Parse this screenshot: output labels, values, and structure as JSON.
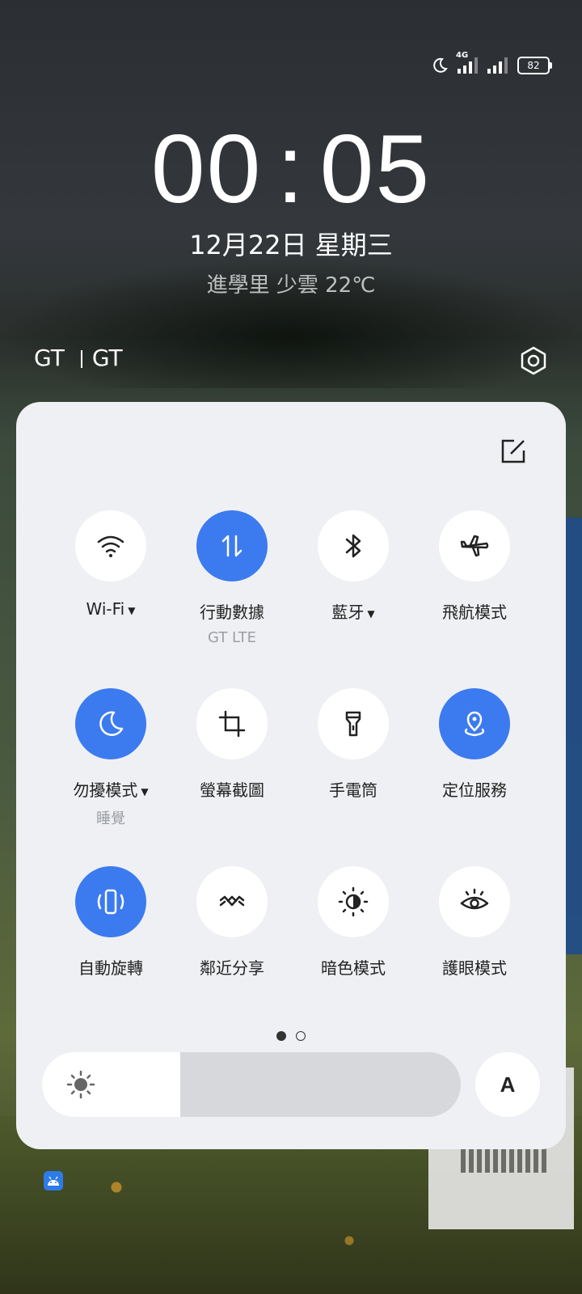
{
  "status_bar": {
    "network_type": "4G",
    "battery_level": "82",
    "icons": [
      "moon-icon",
      "signal-4g-icon",
      "signal-icon",
      "battery-icon"
    ]
  },
  "lockscreen": {
    "time_hours": "00",
    "time_separator": ":",
    "time_minutes": "05",
    "date": "12月22日  星期三",
    "weather": "進學里 少雲 22℃"
  },
  "carrier": {
    "sim1": "GT",
    "sim2": "GT"
  },
  "quick_settings": {
    "accent_color": "#3c7bef",
    "tiles": [
      {
        "label": "Wi-Fi",
        "sub": "",
        "active": false,
        "has_menu": true,
        "icon": "wifi-icon"
      },
      {
        "label": "行動數據",
        "sub": "GT  LTE",
        "active": true,
        "has_menu": false,
        "icon": "mobile-data-icon"
      },
      {
        "label": "藍牙",
        "sub": "",
        "active": false,
        "has_menu": true,
        "icon": "bluetooth-icon"
      },
      {
        "label": "飛航模式",
        "sub": "",
        "active": false,
        "has_menu": false,
        "icon": "airplane-icon"
      },
      {
        "label": "勿擾模式",
        "sub": "睡覺",
        "active": true,
        "has_menu": true,
        "icon": "moon-icon"
      },
      {
        "label": "螢幕截圖",
        "sub": "",
        "active": false,
        "has_menu": false,
        "icon": "crop-icon"
      },
      {
        "label": "手電筒",
        "sub": "",
        "active": false,
        "has_menu": false,
        "icon": "flashlight-icon"
      },
      {
        "label": "定位服務",
        "sub": "",
        "active": true,
        "has_menu": false,
        "icon": "location-icon"
      },
      {
        "label": "自動旋轉",
        "sub": "",
        "active": true,
        "has_menu": false,
        "icon": "auto-rotate-icon"
      },
      {
        "label": "鄰近分享",
        "sub": "",
        "active": false,
        "has_menu": false,
        "icon": "nearby-share-icon"
      },
      {
        "label": "暗色模式",
        "sub": "",
        "active": false,
        "has_menu": false,
        "icon": "dark-mode-icon"
      },
      {
        "label": "護眼模式",
        "sub": "",
        "active": false,
        "has_menu": false,
        "icon": "eye-comfort-icon"
      }
    ],
    "page_indicator": {
      "pages": 2,
      "current": 1
    },
    "brightness_level": 0.33,
    "auto_brightness_label": "A"
  }
}
